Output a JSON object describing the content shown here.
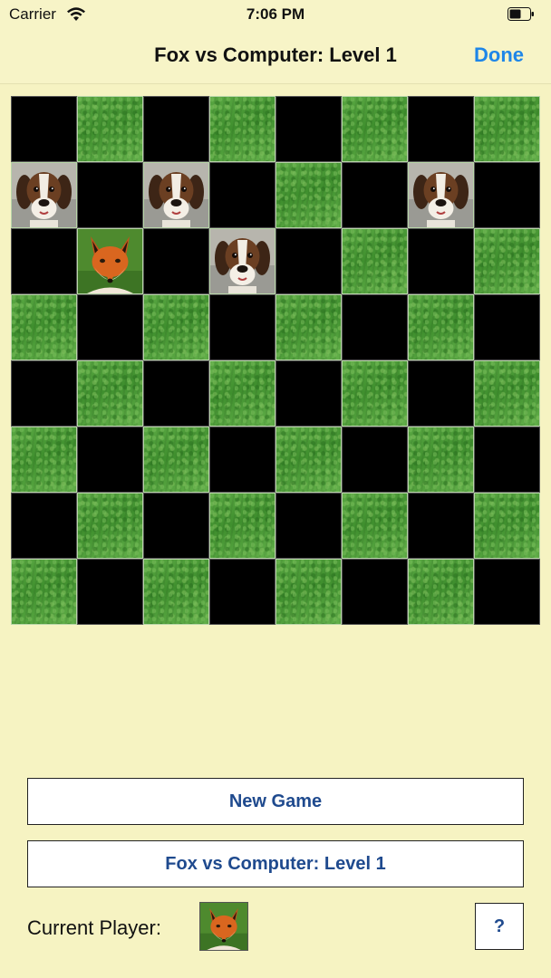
{
  "status_bar": {
    "carrier": "Carrier",
    "time": "7:06 PM"
  },
  "nav": {
    "title": "Fox vs Computer: Level 1",
    "done_label": "Done"
  },
  "board": {
    "size": 8,
    "light_square_style": "grass",
    "dark_square_color": "#000000",
    "top_left_is_dark": true,
    "pieces": [
      {
        "row": 1,
        "col": 0,
        "type": "dog"
      },
      {
        "row": 1,
        "col": 2,
        "type": "dog"
      },
      {
        "row": 1,
        "col": 6,
        "type": "dog"
      },
      {
        "row": 2,
        "col": 1,
        "type": "fox"
      },
      {
        "row": 2,
        "col": 3,
        "type": "dog"
      }
    ]
  },
  "controls": {
    "new_game_label": "New Game",
    "mode_label": "Fox vs Computer: Level 1",
    "current_player_label": "Current Player:",
    "current_player_piece": "fox",
    "help_label": "?"
  },
  "colors": {
    "background": "#f6f3c2",
    "accent": "#1e86e8",
    "button_text": "#1f4a8e"
  }
}
